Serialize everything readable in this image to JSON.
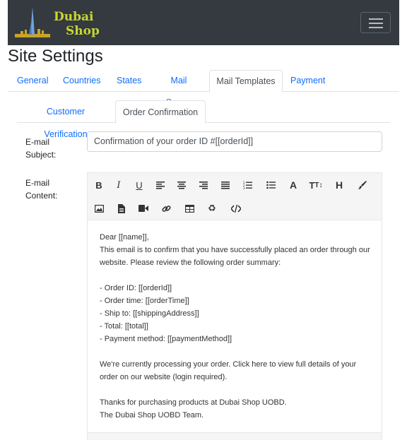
{
  "brand": {
    "line1": "Dubai",
    "line2": "Shop"
  },
  "page": {
    "title": "Site Settings"
  },
  "main_tabs": [
    {
      "label": "General"
    },
    {
      "label": "Countries"
    },
    {
      "label": "States"
    },
    {
      "label": "Mail Server"
    },
    {
      "label": "Mail Templates"
    },
    {
      "label": "Payment"
    }
  ],
  "template_tabs": [
    {
      "label": "Customer Verification"
    },
    {
      "label": "Order Confirmation"
    }
  ],
  "form": {
    "subject_label_1": "E-mail",
    "subject_label_2": "Subject:",
    "subject_value": "Confirmation of your order ID #[[orderId]]",
    "content_label_1": "E-mail",
    "content_label_2": "Content:"
  },
  "toolbar_icons": [
    "bold-icon",
    "italic-icon",
    "underline-icon",
    "align-left-icon",
    "align-center-icon",
    "align-right-icon",
    "align-justify-icon",
    "ordered-list-icon",
    "unordered-list-icon",
    "font-color-icon",
    "font-size-icon",
    "heading-icon",
    "brush-icon",
    "image-icon",
    "file-icon",
    "video-icon",
    "link-icon",
    "table-icon",
    "recycle-icon",
    "code-view-icon"
  ],
  "email_body": [
    "Dear [[name]],",
    "This email is to confirm that you have successfully placed an order through our website. Please review the following order summary:",
    "",
    "- Order ID: [[orderId]]",
    "- Order time: [[orderTime]]",
    "- Ship to: [[shippingAddress]]",
    "- Total: [[total]]",
    "- Payment method: [[paymentMethod]]",
    "",
    "We're currently processing your order. Click here to view full details of your order on our website (login required).",
    "",
    "Thanks for purchasing products at Dubai Shop UOBD.",
    "The Dubai Shop UOBD Team."
  ]
}
